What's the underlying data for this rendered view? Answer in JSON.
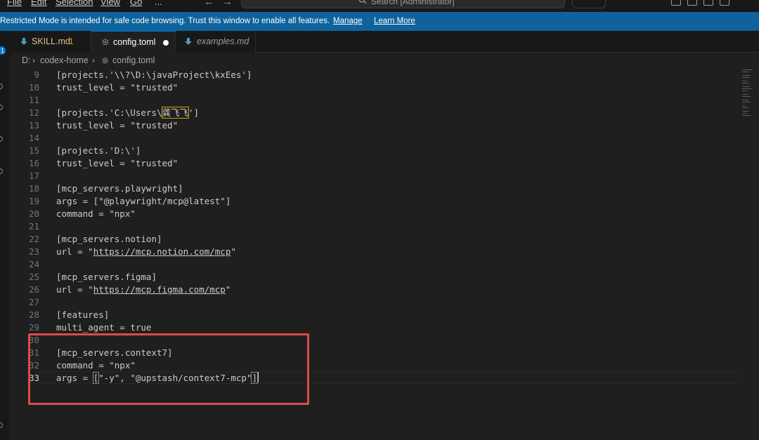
{
  "menu": {
    "items": [
      "File",
      "Edit",
      "Selection",
      "View",
      "Go",
      "..."
    ]
  },
  "search": {
    "text": "Search [Administrator]"
  },
  "banner": {
    "message": "Restricted Mode is intended for safe code browsing. Trust this window to enable all features.",
    "manage_label": "Manage",
    "learn_more_label": "Learn More"
  },
  "activity": {
    "badge": "1"
  },
  "tabs": [
    {
      "label": "SKILL.md",
      "badge": "1",
      "icon": "markdown-download-icon",
      "color": "#e2c08d"
    },
    {
      "label": "config.toml",
      "icon": "gear-icon",
      "modified": true,
      "color": "#ffffff"
    },
    {
      "label": "examples.md",
      "icon": "markdown-download-icon",
      "color": "#9d9d9d"
    }
  ],
  "breadcrumb": {
    "items": [
      "D:",
      "codex-home",
      "config.toml"
    ]
  },
  "editor": {
    "current_line": "33",
    "lines": [
      {
        "no": "9",
        "text": "[projects.'\\\\?\\D:\\javaProject\\kxEes']"
      },
      {
        "no": "10",
        "text": "trust_level = \"trusted\""
      },
      {
        "no": "11",
        "text": ""
      },
      {
        "no": "12",
        "pre": "[projects.'C:\\Users\\",
        "hl": "龚飞飞",
        "post": "']"
      },
      {
        "no": "13",
        "text": "trust_level = \"trusted\""
      },
      {
        "no": "14",
        "text": ""
      },
      {
        "no": "15",
        "text": "[projects.'D:\\']"
      },
      {
        "no": "16",
        "text": "trust_level = \"trusted\""
      },
      {
        "no": "17",
        "text": ""
      },
      {
        "no": "18",
        "text": "[mcp_servers.playwright]"
      },
      {
        "no": "19",
        "text": "args = [\"@playwright/mcp@latest\"]"
      },
      {
        "no": "20",
        "text": "command = \"npx\""
      },
      {
        "no": "21",
        "text": ""
      },
      {
        "no": "22",
        "text": "[mcp_servers.notion]"
      },
      {
        "no": "23",
        "pre": "url = \"",
        "url": "https://mcp.notion.com/mcp",
        "post": "\""
      },
      {
        "no": "24",
        "text": ""
      },
      {
        "no": "25",
        "text": "[mcp_servers.figma]"
      },
      {
        "no": "26",
        "pre": "url = \"",
        "url": "https://mcp.figma.com/mcp",
        "post": "\""
      },
      {
        "no": "27",
        "text": ""
      },
      {
        "no": "28",
        "text": "[features]"
      },
      {
        "no": "29",
        "text": "multi_agent = true"
      },
      {
        "no": "30",
        "text": ""
      },
      {
        "no": "31",
        "text": "[mcp_servers.context7]"
      },
      {
        "no": "32",
        "text": "command = \"npx\""
      },
      {
        "no": "33",
        "pre": "args = ",
        "open": "[",
        "mid": "\"-y\", \"@upstash/context7-mcp\"",
        "close": "]"
      }
    ]
  },
  "colors": {
    "banner": "#0e639c",
    "annotation": "#e04a4a",
    "highlight": "#cca700"
  }
}
